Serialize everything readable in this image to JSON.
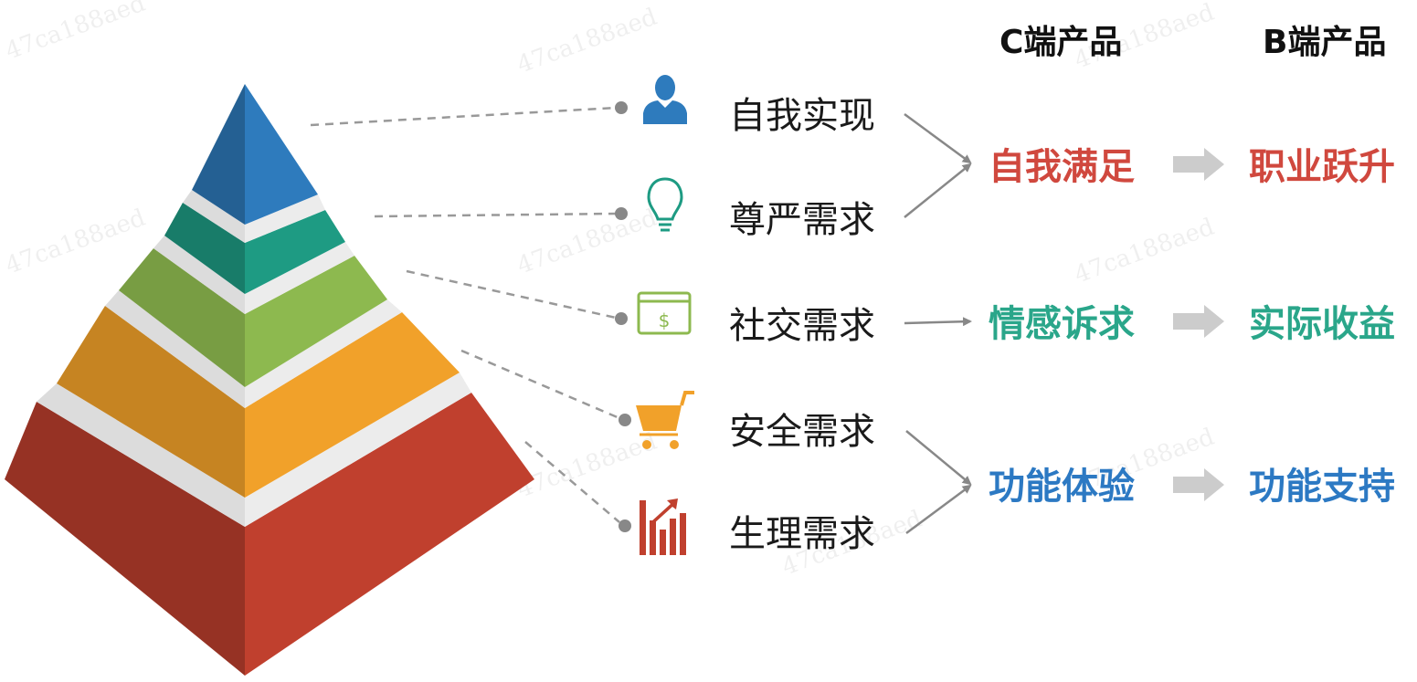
{
  "colors": {
    "level_top": "#2e7bbd",
    "level_2": "#1e9b83",
    "level_3": "#8db94f",
    "level_4": "#f1a12a",
    "level_5": "#c0402e",
    "arrow_gray": "#cccccc",
    "connector_gray": "#888888",
    "red_text": "#d0483e",
    "teal_text": "#2aa68a",
    "blue_text": "#2c79c3"
  },
  "headers": {
    "c_side": "C端产品",
    "b_side": "B端产品"
  },
  "levels": [
    {
      "label": "自我实现",
      "icon": "person-icon"
    },
    {
      "label": "尊严需求",
      "icon": "lightbulb-icon"
    },
    {
      "label": "社交需求",
      "icon": "money-card-icon"
    },
    {
      "label": "安全需求",
      "icon": "cart-icon"
    },
    {
      "label": "生理需求",
      "icon": "bar-chart-icon"
    }
  ],
  "groups": [
    {
      "c_label": "自我满足",
      "b_label": "职业跃升",
      "color": "#d0483e"
    },
    {
      "c_label": "情感诉求",
      "b_label": "实际收益",
      "color": "#2aa68a"
    },
    {
      "c_label": "功能体验",
      "b_label": "功能支持",
      "color": "#2c79c3"
    }
  ],
  "watermark": "47ca188aed"
}
